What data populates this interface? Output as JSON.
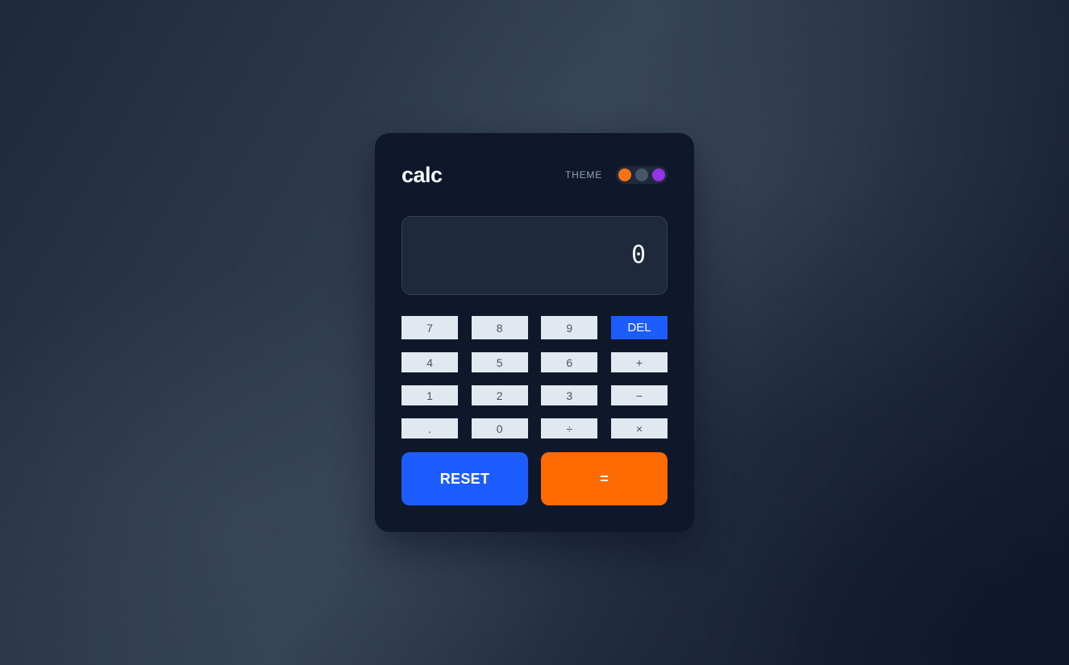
{
  "app": {
    "title": "calc"
  },
  "theme": {
    "label": "THEME",
    "options": [
      {
        "name": "orange",
        "color": "#f97316"
      },
      {
        "name": "gray",
        "color": "#475569"
      },
      {
        "name": "purple",
        "color": "#9333ea"
      }
    ],
    "selected": "orange"
  },
  "display": {
    "value": "0"
  },
  "keypad": {
    "rows": [
      [
        "7",
        "8",
        "9",
        "DEL"
      ],
      [
        "4",
        "5",
        "6",
        "+"
      ],
      [
        "1",
        "2",
        "3",
        "−"
      ],
      [
        ".",
        "0",
        "÷",
        "×"
      ]
    ]
  },
  "actions": {
    "reset_label": "RESET",
    "equals_label": "="
  },
  "colors": {
    "accent_blue": "#1d5cff",
    "accent_orange": "#ff6b00",
    "panel": "#0f172a",
    "display_bg": "#1e293b",
    "key_bg": "#e2e8f0"
  }
}
